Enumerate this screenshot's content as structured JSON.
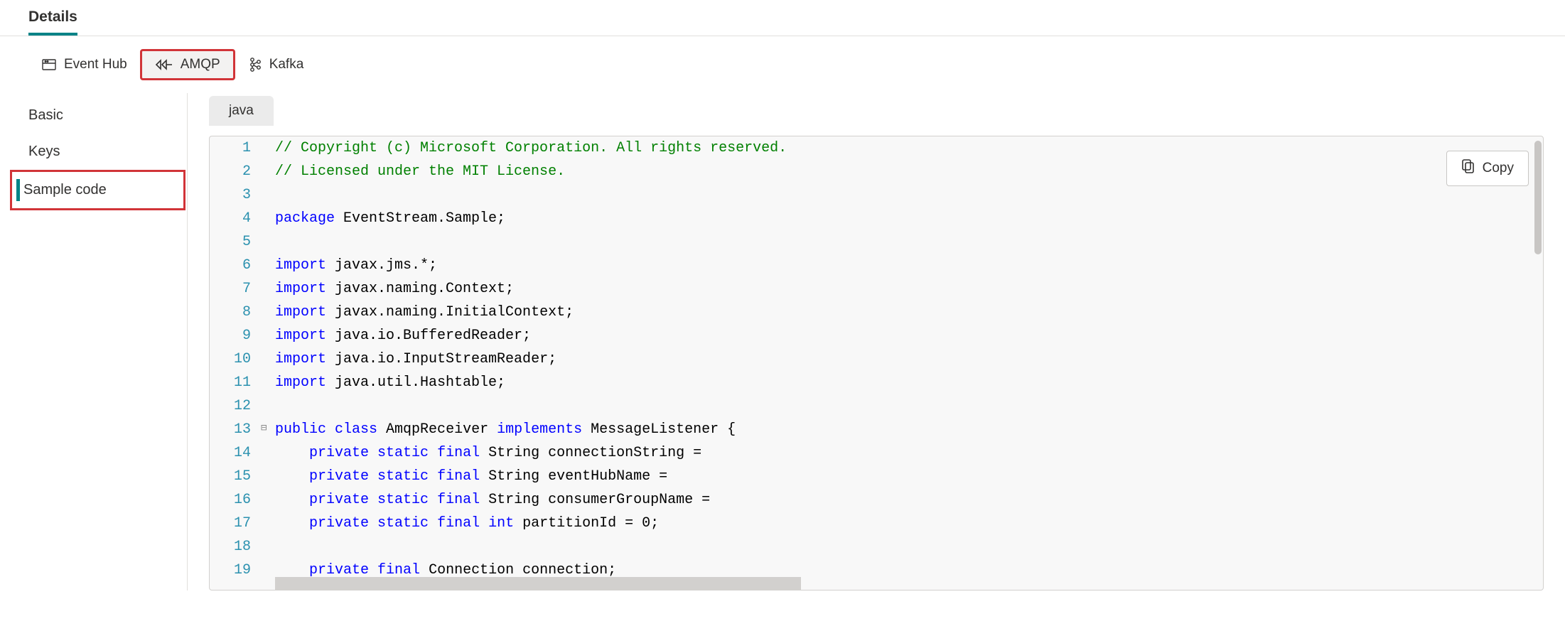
{
  "header": {
    "title": "Details"
  },
  "protocol_tabs": [
    {
      "id": "eventhub",
      "label": "Event Hub",
      "icon": "eventhub"
    },
    {
      "id": "amqp",
      "label": "AMQP",
      "icon": "amqp",
      "selected": true,
      "highlighted": true
    },
    {
      "id": "kafka",
      "label": "Kafka",
      "icon": "kafka"
    }
  ],
  "sidebar": {
    "items": [
      {
        "id": "basic",
        "label": "Basic"
      },
      {
        "id": "keys",
        "label": "Keys"
      },
      {
        "id": "sample",
        "label": "Sample code",
        "active": true,
        "highlighted": true
      }
    ]
  },
  "content": {
    "language_tab": "java",
    "copy_label": "Copy"
  },
  "code": {
    "lines": [
      {
        "n": 1,
        "gutter": "",
        "tokens": [
          {
            "t": "comment",
            "v": "// Copyright (c) Microsoft Corporation. All rights reserved."
          }
        ]
      },
      {
        "n": 2,
        "gutter": "",
        "tokens": [
          {
            "t": "comment",
            "v": "// Licensed under the MIT License."
          }
        ]
      },
      {
        "n": 3,
        "gutter": "",
        "tokens": []
      },
      {
        "n": 4,
        "gutter": "",
        "tokens": [
          {
            "t": "keyword",
            "v": "package"
          },
          {
            "t": "plain",
            "v": " EventStream.Sample;"
          }
        ]
      },
      {
        "n": 5,
        "gutter": "",
        "tokens": []
      },
      {
        "n": 6,
        "gutter": "",
        "tokens": [
          {
            "t": "keyword",
            "v": "import"
          },
          {
            "t": "plain",
            "v": " javax.jms.*;"
          }
        ]
      },
      {
        "n": 7,
        "gutter": "",
        "tokens": [
          {
            "t": "keyword",
            "v": "import"
          },
          {
            "t": "plain",
            "v": " javax.naming.Context;"
          }
        ]
      },
      {
        "n": 8,
        "gutter": "",
        "tokens": [
          {
            "t": "keyword",
            "v": "import"
          },
          {
            "t": "plain",
            "v": " javax.naming.InitialContext;"
          }
        ]
      },
      {
        "n": 9,
        "gutter": "",
        "tokens": [
          {
            "t": "keyword",
            "v": "import"
          },
          {
            "t": "plain",
            "v": " java.io.BufferedReader;"
          }
        ]
      },
      {
        "n": 10,
        "gutter": "",
        "tokens": [
          {
            "t": "keyword",
            "v": "import"
          },
          {
            "t": "plain",
            "v": " java.io.InputStreamReader;"
          }
        ]
      },
      {
        "n": 11,
        "gutter": "",
        "tokens": [
          {
            "t": "keyword",
            "v": "import"
          },
          {
            "t": "plain",
            "v": " java.util.Hashtable;"
          }
        ]
      },
      {
        "n": 12,
        "gutter": "",
        "tokens": []
      },
      {
        "n": 13,
        "gutter": "⊟",
        "tokens": [
          {
            "t": "keyword",
            "v": "public"
          },
          {
            "t": "plain",
            "v": " "
          },
          {
            "t": "keyword",
            "v": "class"
          },
          {
            "t": "plain",
            "v": " AmqpReceiver "
          },
          {
            "t": "keyword",
            "v": "implements"
          },
          {
            "t": "plain",
            "v": " MessageListener {"
          }
        ]
      },
      {
        "n": 14,
        "gutter": "",
        "tokens": [
          {
            "t": "plain",
            "v": "    "
          },
          {
            "t": "keyword",
            "v": "private"
          },
          {
            "t": "plain",
            "v": " "
          },
          {
            "t": "keyword",
            "v": "static"
          },
          {
            "t": "plain",
            "v": " "
          },
          {
            "t": "keyword",
            "v": "final"
          },
          {
            "t": "plain",
            "v": " String connectionString ="
          }
        ]
      },
      {
        "n": 15,
        "gutter": "",
        "tokens": [
          {
            "t": "plain",
            "v": "    "
          },
          {
            "t": "keyword",
            "v": "private"
          },
          {
            "t": "plain",
            "v": " "
          },
          {
            "t": "keyword",
            "v": "static"
          },
          {
            "t": "plain",
            "v": " "
          },
          {
            "t": "keyword",
            "v": "final"
          },
          {
            "t": "plain",
            "v": " String eventHubName ="
          }
        ]
      },
      {
        "n": 16,
        "gutter": "",
        "tokens": [
          {
            "t": "plain",
            "v": "    "
          },
          {
            "t": "keyword",
            "v": "private"
          },
          {
            "t": "plain",
            "v": " "
          },
          {
            "t": "keyword",
            "v": "static"
          },
          {
            "t": "plain",
            "v": " "
          },
          {
            "t": "keyword",
            "v": "final"
          },
          {
            "t": "plain",
            "v": " String consumerGroupName ="
          }
        ]
      },
      {
        "n": 17,
        "gutter": "",
        "tokens": [
          {
            "t": "plain",
            "v": "    "
          },
          {
            "t": "keyword",
            "v": "private"
          },
          {
            "t": "plain",
            "v": " "
          },
          {
            "t": "keyword",
            "v": "static"
          },
          {
            "t": "plain",
            "v": " "
          },
          {
            "t": "keyword",
            "v": "final"
          },
          {
            "t": "plain",
            "v": " "
          },
          {
            "t": "keyword",
            "v": "int"
          },
          {
            "t": "plain",
            "v": " partitionId = 0;"
          }
        ]
      },
      {
        "n": 18,
        "gutter": "",
        "tokens": []
      },
      {
        "n": 19,
        "gutter": "",
        "tokens": [
          {
            "t": "plain",
            "v": "    "
          },
          {
            "t": "keyword",
            "v": "private"
          },
          {
            "t": "plain",
            "v": " "
          },
          {
            "t": "keyword",
            "v": "final"
          },
          {
            "t": "plain",
            "v": " Connection connection;"
          }
        ]
      }
    ]
  }
}
